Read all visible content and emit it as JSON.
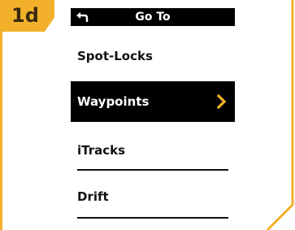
{
  "step_label": "1d",
  "header": {
    "title": "Go To",
    "back_icon": "back-arrow-icon"
  },
  "menu": {
    "items": [
      {
        "label": "Spot-Locks",
        "selected": false
      },
      {
        "label": "Waypoints",
        "selected": true,
        "icon": "chevron-right-icon"
      },
      {
        "label": "iTracks",
        "selected": false
      },
      {
        "label": "Drift",
        "selected": false
      }
    ]
  },
  "colors": {
    "accent": "#f3b12b",
    "selected_bg": "#000000",
    "selected_fg": "#ffffff",
    "chevron": "#f3b12b"
  }
}
